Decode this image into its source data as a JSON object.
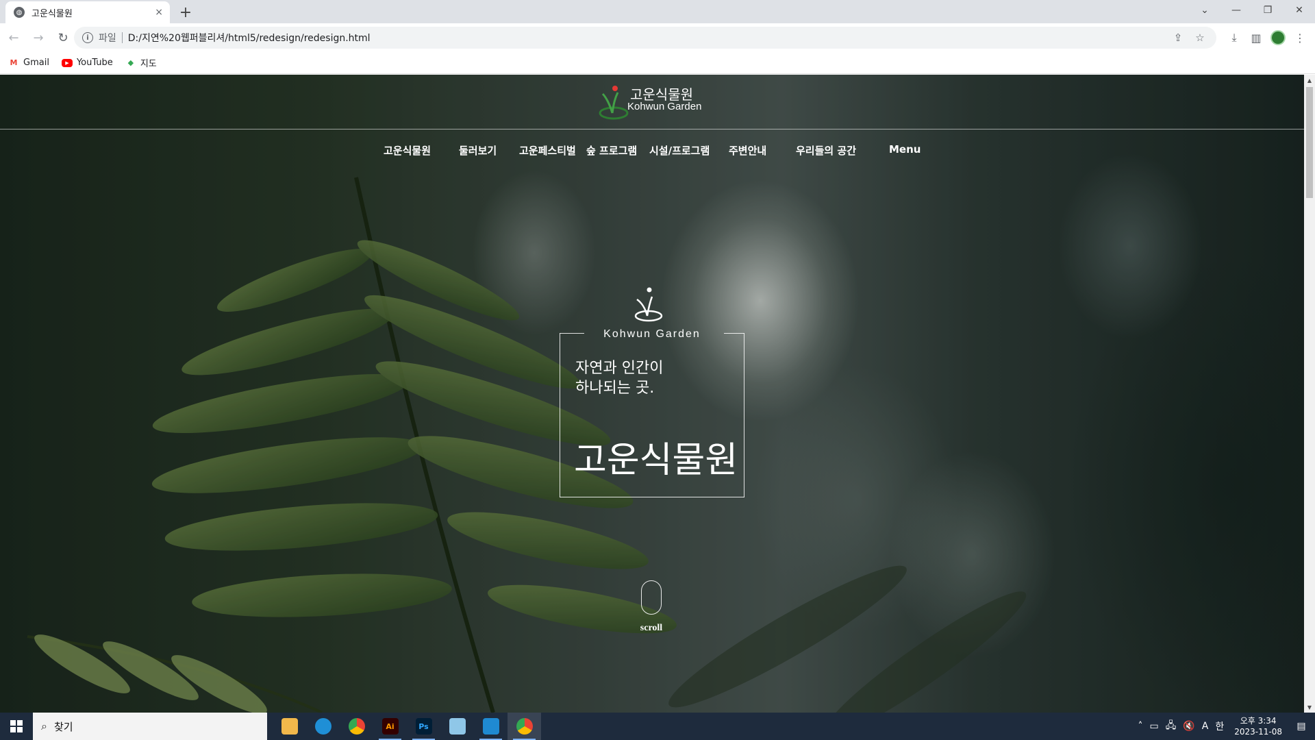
{
  "browser": {
    "tab_title": "고운식물원",
    "tab_close": "×",
    "new_tab": "+",
    "window_controls": [
      "⌄",
      "—",
      "❐",
      "✕"
    ],
    "scheme_label": "파일",
    "url": "D:/지연%20웹퍼블리셔/html5/redesign/redesign.html",
    "bookmarks": [
      {
        "label": "Gmail",
        "icon": "gmail-icon"
      },
      {
        "label": "YouTube",
        "icon": "youtube-icon"
      },
      {
        "label": "지도",
        "icon": "maps-icon"
      }
    ]
  },
  "site": {
    "logo_ko": "고운식물원",
    "logo_en": "Kohwun Garden",
    "nav": [
      "고운식물원",
      "둘러보기",
      "고운페스티벌",
      "숲 프로그램",
      "시설/프로그램",
      "주변안내",
      "우리들의 공간",
      "Menu"
    ],
    "hero_en": "Kohwun Garden",
    "hero_slogan_line1": "자연과 인간이",
    "hero_slogan_line2": "하나되는 곳.",
    "hero_name": "고운식물원",
    "scroll_label": "scroll"
  },
  "taskbar": {
    "search_text": "찾기",
    "apps": [
      {
        "name": "file-explorer",
        "label": ""
      },
      {
        "name": "edge",
        "label": ""
      },
      {
        "name": "chrome",
        "label": ""
      },
      {
        "name": "illustrator",
        "label": "Ai"
      },
      {
        "name": "photoshop",
        "label": "Ps"
      },
      {
        "name": "notepad",
        "label": ""
      },
      {
        "name": "vscode",
        "label": ""
      },
      {
        "name": "chrome-active",
        "label": ""
      }
    ],
    "time": "오후 3:34",
    "date": "2023-11-08",
    "ime": "A",
    "ime2": "한"
  },
  "colors": {
    "chrome_bg": "#dee1e6",
    "taskbar_bg": "#1e2b3d",
    "logo_red": "#e53935",
    "logo_green": "#2e7d32"
  }
}
